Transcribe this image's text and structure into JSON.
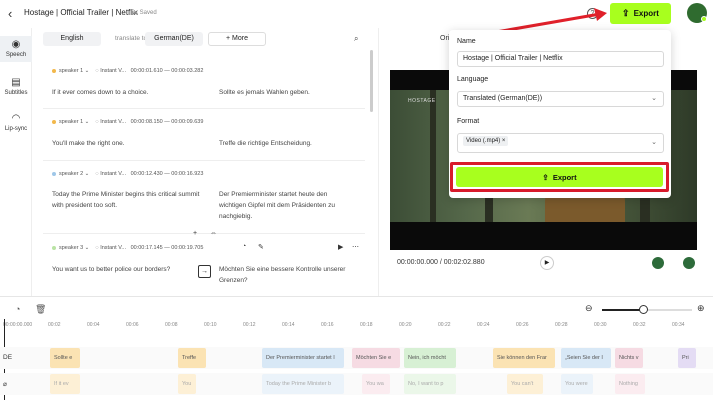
{
  "topbar": {
    "title": "Hostage | Official Trailer | Netflix",
    "saved": "Saved",
    "export_label": "Export",
    "help": "?"
  },
  "rail": {
    "items": [
      {
        "label": "Speech"
      },
      {
        "label": "Subtitles"
      },
      {
        "label": "Lip-sync"
      }
    ]
  },
  "editor": {
    "source_lang": "English",
    "translate_to": "translate to",
    "target_lang": "German(DE)",
    "more": "+ More",
    "segments": [
      {
        "speaker": "speaker 1",
        "voice": "Instant V...",
        "start": "00:00:01.610",
        "end": "00:00:03.282",
        "src": "If it ever comes down to a choice.",
        "tgt": "Sollte es jemals Wahlen geben.",
        "color": "#f2b84b"
      },
      {
        "speaker": "speaker 1",
        "voice": "Instant V...",
        "start": "00:00:08.150",
        "end": "00:00:09.639",
        "src": "You'll make the right one.",
        "tgt": "Treffe die richtige Entscheidung.",
        "color": "#f2b84b"
      },
      {
        "speaker": "speaker 2",
        "voice": "Instant V...",
        "start": "00:00:12.430",
        "end": "00:00:16.923",
        "src": "Today the Prime Minister begins this critical summit with president too soft.",
        "tgt": "Der Premierminister startet heute den wichtigen Gipfel mit dem Präsidenten zu nachgiebig.",
        "color": "#9fc7e8"
      },
      {
        "speaker": "speaker 3",
        "voice": "Instant V...",
        "start": "00:00:17.145",
        "end": "00:00:19.705",
        "src": "You want us to better police our borders?",
        "tgt": "Möchten Sie eine bessere Kontrolle unserer Grenzen?",
        "color": "#b9e3a4"
      }
    ]
  },
  "preview": {
    "tab_label": "Ori",
    "video_overlay": "HOSTAGE",
    "current_time": "00:00:00.000",
    "duration": "00:02:02.880"
  },
  "dialog": {
    "name_label": "Name",
    "name_value": "Hostage | Official Trailer | Netflix",
    "language_label": "Language",
    "language_value": "Translated (German(DE))",
    "format_label": "Format",
    "format_chip": "Video (.mp4)",
    "export_label": "Export"
  },
  "timeline": {
    "zoom_level": 0.45,
    "ticks": [
      "00:00:00.000",
      "00:02",
      "00:04",
      "00:06",
      "00:08",
      "00:10",
      "00:12",
      "00:14",
      "00:16",
      "00:18",
      "00:20",
      "00:22",
      "00:24",
      "00:26",
      "00:28",
      "00:30",
      "00:32",
      "00:34"
    ],
    "track_de_label": "DE",
    "track_src_label": "⌀",
    "clips_de": [
      {
        "text": "Sollte e",
        "color": "#fbe3b3"
      },
      {
        "text": "Treffe",
        "color": "#fbe3b3"
      },
      {
        "text": "Der Premierminister startet I",
        "color": "#d8e8f6"
      },
      {
        "text": "Möchten Sie e",
        "color": "#f6dbe3"
      },
      {
        "text": "Nein, ich möcht",
        "color": "#d7f0d4"
      },
      {
        "text": "Sie können den Frar",
        "color": "#fbe3b3"
      },
      {
        "text": "„Seien Sie der I",
        "color": "#d8e8f6"
      },
      {
        "text": "Nichts v",
        "color": "#f6dbe3"
      },
      {
        "text": "Pri",
        "color": "#e4dcf4"
      }
    ],
    "clips_src": [
      {
        "text": "If it ev",
        "color": "#fdf0d6"
      },
      {
        "text": "You",
        "color": "#fdf0d6"
      },
      {
        "text": "Today the Prime Minister b",
        "color": "#ebf3fa"
      },
      {
        "text": "You wa",
        "color": "#fbecf0"
      },
      {
        "text": "No, I want to p",
        "color": "#ebf7e9"
      },
      {
        "text": "You can't",
        "color": "#fdf0d6"
      },
      {
        "text": "You were",
        "color": "#ebf3fa"
      },
      {
        "text": "Nothing",
        "color": "#fbecf0"
      }
    ]
  }
}
